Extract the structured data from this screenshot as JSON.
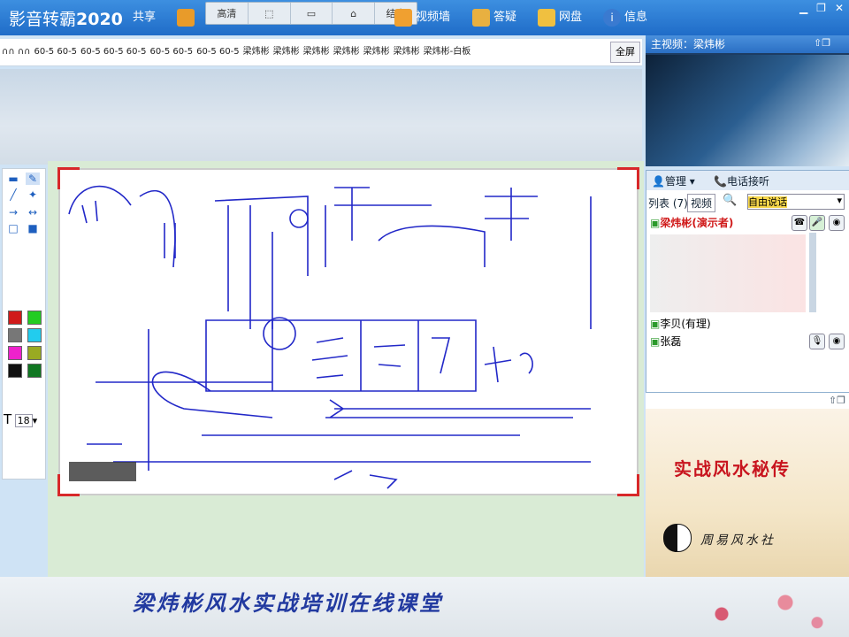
{
  "app": {
    "brand_prefix": "影音转霸",
    "brand_year": "2020"
  },
  "toolbar": {
    "share_label": "共享",
    "mini": [
      "高清",
      "",
      "",
      "",
      "结束"
    ],
    "video_wall_label": "视频墙",
    "qa_label": "答疑",
    "netdisk_label": "网盘",
    "info_label": "信息"
  },
  "tabs": [
    "∩∩ ∩∩",
    "60-5 60-5",
    "60-5 60-5 60-5",
    "60-5 60-5",
    "60-5 60-5",
    "梁炜彬",
    "梁炜彬",
    "梁炜彬",
    "梁炜彬",
    "梁炜彬",
    "梁炜彬",
    "梁炜彬-白板"
  ],
  "fullscreen_label": "全屏",
  "font_size": "18",
  "main_video": {
    "title": "主视频：梁炜彬"
  },
  "manage": {
    "menu_label": "管理",
    "phone_label": "电话接听",
    "list_tab": "列表 (7)",
    "video_tab": "视频",
    "mode_select": "自由说话",
    "users": [
      {
        "name": "梁炜彬(演示者)",
        "color": "#d01a1a"
      },
      {
        "name": "",
        "color": "#222"
      },
      {
        "name": "李贝(有理)",
        "color": "#222"
      },
      {
        "name": "张磊",
        "color": "#222"
      }
    ]
  },
  "poster": {
    "title": "实战风水秘传",
    "subtitle": "周易风水社"
  },
  "footer": {
    "text": "梁炜彬风水实战培训在线课堂"
  },
  "colors": {
    "accent": "#2a6fc4",
    "board_border": "#d8282a",
    "poster_red": "#c8141e"
  },
  "palette_colors": [
    "#d01a1a",
    "#22cc22",
    "#777777",
    "#22ccee",
    "#ee22cc",
    "#99aa22",
    "#111111",
    "#117722",
    "#1a2ad0",
    "#880000"
  ]
}
